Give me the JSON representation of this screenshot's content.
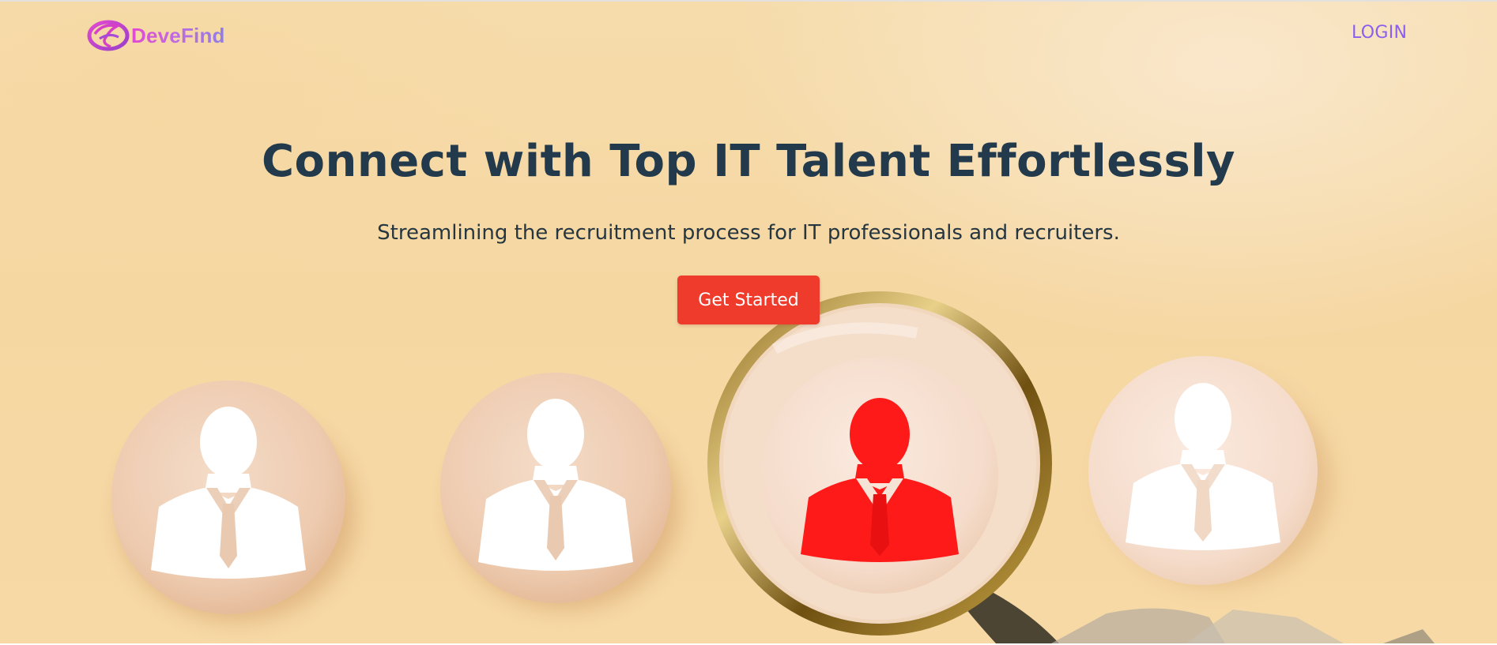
{
  "brand": {
    "name": "DeveFind",
    "colors": {
      "gradient_start": "#e14ad0",
      "gradient_end": "#8f7ee8"
    },
    "icon": "swirl-logo-icon"
  },
  "nav": {
    "login_label": "LOGIN",
    "login_color": "#8a5ff0"
  },
  "hero": {
    "title": "Connect with Top IT Talent Effortlessly",
    "subtitle": "Streamlining the recruitment process for IT professionals and recruiters.",
    "cta_label": "Get Started",
    "cta_color": "#ef3b2c",
    "background_image": "wooden discs with person silhouettes under magnifying glass",
    "figures": [
      {
        "icon": "person-silhouette-icon",
        "color": "#ffffff"
      },
      {
        "icon": "person-silhouette-icon",
        "color": "#ffffff"
      },
      {
        "icon": "person-silhouette-icon",
        "color": "#ff1515",
        "highlighted": true
      },
      {
        "icon": "person-silhouette-icon",
        "color": "#ffffff"
      }
    ],
    "magnifier_icon": "magnifying-glass-icon"
  }
}
